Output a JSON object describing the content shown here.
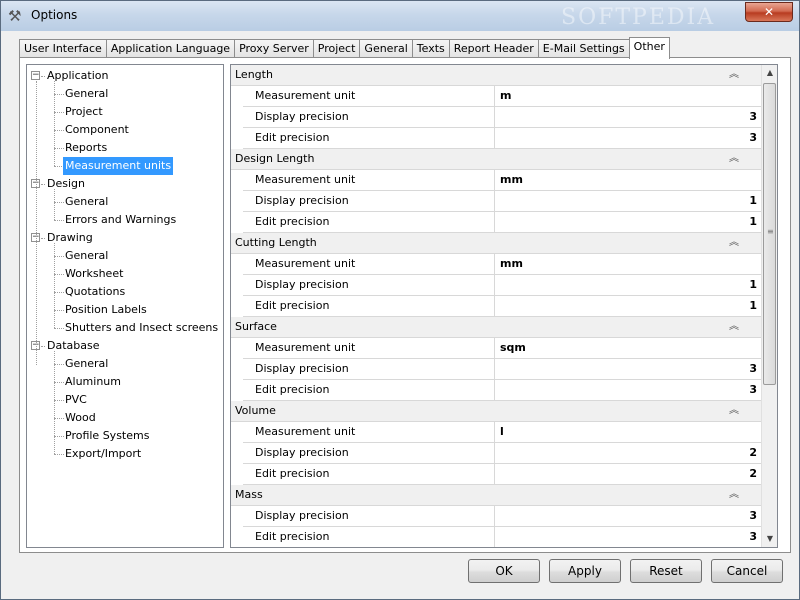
{
  "window": {
    "title": "Options",
    "watermark": "SOFTPEDIA",
    "close_glyph": "✕",
    "app_icon": "tools-icon"
  },
  "tabs": [
    {
      "label": "User Interface"
    },
    {
      "label": "Application Language"
    },
    {
      "label": "Proxy Server"
    },
    {
      "label": "Project"
    },
    {
      "label": "General"
    },
    {
      "label": "Texts"
    },
    {
      "label": "Report Header"
    },
    {
      "label": "E-Mail Settings"
    },
    {
      "label": "Other",
      "active": true
    }
  ],
  "tree": {
    "groups": [
      {
        "label": "Application",
        "expanded": true,
        "children": [
          "General",
          "Project",
          "Component",
          "Reports",
          "Measurement units"
        ]
      },
      {
        "label": "Design",
        "expanded": true,
        "children": [
          "General",
          "Errors and Warnings"
        ]
      },
      {
        "label": "Drawing",
        "expanded": true,
        "children": [
          "General",
          "Worksheet",
          "Quotations",
          "Position Labels",
          "Shutters and Insect screens"
        ]
      },
      {
        "label": "Database",
        "expanded": true,
        "children": [
          "General",
          "Aluminum",
          "PVC",
          "Wood",
          "Profile Systems",
          "Export/Import"
        ]
      }
    ],
    "selected": "Measurement units"
  },
  "properties": {
    "categories": [
      {
        "label": "Length",
        "rows": [
          {
            "name": "Measurement unit",
            "value": "m",
            "numeric": false
          },
          {
            "name": "Display precision",
            "value": "3",
            "numeric": true
          },
          {
            "name": "Edit precision",
            "value": "3",
            "numeric": true
          }
        ]
      },
      {
        "label": "Design Length",
        "rows": [
          {
            "name": "Measurement unit",
            "value": "mm",
            "numeric": false
          },
          {
            "name": "Display precision",
            "value": "1",
            "numeric": true
          },
          {
            "name": "Edit precision",
            "value": "1",
            "numeric": true
          }
        ]
      },
      {
        "label": "Cutting Length",
        "rows": [
          {
            "name": "Measurement unit",
            "value": "mm",
            "numeric": false
          },
          {
            "name": "Display precision",
            "value": "1",
            "numeric": true
          },
          {
            "name": "Edit precision",
            "value": "1",
            "numeric": true
          }
        ]
      },
      {
        "label": "Surface",
        "rows": [
          {
            "name": "Measurement unit",
            "value": "sqm",
            "numeric": false
          },
          {
            "name": "Display precision",
            "value": "3",
            "numeric": true
          },
          {
            "name": "Edit precision",
            "value": "3",
            "numeric": true
          }
        ]
      },
      {
        "label": "Volume",
        "rows": [
          {
            "name": "Measurement unit",
            "value": "l",
            "numeric": false
          },
          {
            "name": "Display precision",
            "value": "2",
            "numeric": true
          },
          {
            "name": "Edit precision",
            "value": "2",
            "numeric": true
          }
        ]
      },
      {
        "label": "Mass",
        "rows": [
          {
            "name": "Display precision",
            "value": "3",
            "numeric": true
          },
          {
            "name": "Edit precision",
            "value": "3",
            "numeric": true
          }
        ]
      }
    ],
    "collapse_glyph": "⌃",
    "scroll_up_glyph": "▲",
    "scroll_down_glyph": "▼",
    "scroll_grip_glyph": "≡"
  },
  "buttons": {
    "ok": "OK",
    "apply": "Apply",
    "reset": "Reset",
    "cancel": "Cancel"
  }
}
